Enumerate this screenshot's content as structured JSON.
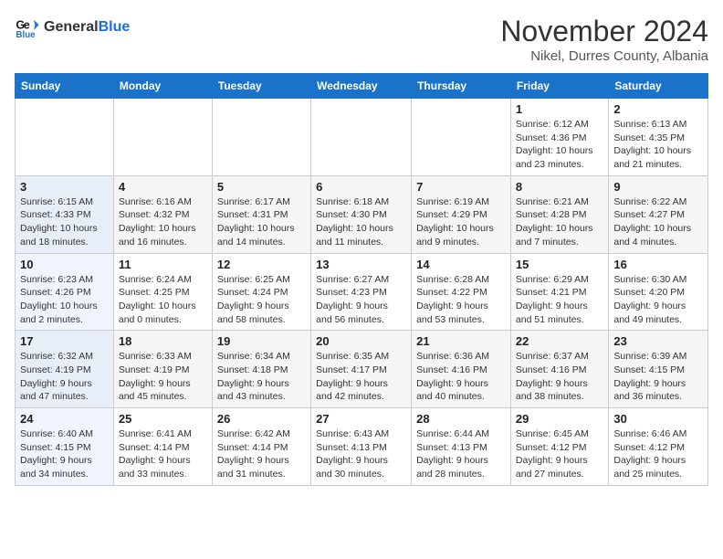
{
  "header": {
    "logo_line1": "General",
    "logo_line2": "Blue",
    "month": "November 2024",
    "location": "Nikel, Durres County, Albania"
  },
  "weekdays": [
    "Sunday",
    "Monday",
    "Tuesday",
    "Wednesday",
    "Thursday",
    "Friday",
    "Saturday"
  ],
  "weeks": [
    [
      {
        "day": "",
        "info": ""
      },
      {
        "day": "",
        "info": ""
      },
      {
        "day": "",
        "info": ""
      },
      {
        "day": "",
        "info": ""
      },
      {
        "day": "",
        "info": ""
      },
      {
        "day": "1",
        "info": "Sunrise: 6:12 AM\nSunset: 4:36 PM\nDaylight: 10 hours\nand 23 minutes."
      },
      {
        "day": "2",
        "info": "Sunrise: 6:13 AM\nSunset: 4:35 PM\nDaylight: 10 hours\nand 21 minutes."
      }
    ],
    [
      {
        "day": "3",
        "info": "Sunrise: 6:15 AM\nSunset: 4:33 PM\nDaylight: 10 hours\nand 18 minutes."
      },
      {
        "day": "4",
        "info": "Sunrise: 6:16 AM\nSunset: 4:32 PM\nDaylight: 10 hours\nand 16 minutes."
      },
      {
        "day": "5",
        "info": "Sunrise: 6:17 AM\nSunset: 4:31 PM\nDaylight: 10 hours\nand 14 minutes."
      },
      {
        "day": "6",
        "info": "Sunrise: 6:18 AM\nSunset: 4:30 PM\nDaylight: 10 hours\nand 11 minutes."
      },
      {
        "day": "7",
        "info": "Sunrise: 6:19 AM\nSunset: 4:29 PM\nDaylight: 10 hours\nand 9 minutes."
      },
      {
        "day": "8",
        "info": "Sunrise: 6:21 AM\nSunset: 4:28 PM\nDaylight: 10 hours\nand 7 minutes."
      },
      {
        "day": "9",
        "info": "Sunrise: 6:22 AM\nSunset: 4:27 PM\nDaylight: 10 hours\nand 4 minutes."
      }
    ],
    [
      {
        "day": "10",
        "info": "Sunrise: 6:23 AM\nSunset: 4:26 PM\nDaylight: 10 hours\nand 2 minutes."
      },
      {
        "day": "11",
        "info": "Sunrise: 6:24 AM\nSunset: 4:25 PM\nDaylight: 10 hours\nand 0 minutes."
      },
      {
        "day": "12",
        "info": "Sunrise: 6:25 AM\nSunset: 4:24 PM\nDaylight: 9 hours\nand 58 minutes."
      },
      {
        "day": "13",
        "info": "Sunrise: 6:27 AM\nSunset: 4:23 PM\nDaylight: 9 hours\nand 56 minutes."
      },
      {
        "day": "14",
        "info": "Sunrise: 6:28 AM\nSunset: 4:22 PM\nDaylight: 9 hours\nand 53 minutes."
      },
      {
        "day": "15",
        "info": "Sunrise: 6:29 AM\nSunset: 4:21 PM\nDaylight: 9 hours\nand 51 minutes."
      },
      {
        "day": "16",
        "info": "Sunrise: 6:30 AM\nSunset: 4:20 PM\nDaylight: 9 hours\nand 49 minutes."
      }
    ],
    [
      {
        "day": "17",
        "info": "Sunrise: 6:32 AM\nSunset: 4:19 PM\nDaylight: 9 hours\nand 47 minutes."
      },
      {
        "day": "18",
        "info": "Sunrise: 6:33 AM\nSunset: 4:19 PM\nDaylight: 9 hours\nand 45 minutes."
      },
      {
        "day": "19",
        "info": "Sunrise: 6:34 AM\nSunset: 4:18 PM\nDaylight: 9 hours\nand 43 minutes."
      },
      {
        "day": "20",
        "info": "Sunrise: 6:35 AM\nSunset: 4:17 PM\nDaylight: 9 hours\nand 42 minutes."
      },
      {
        "day": "21",
        "info": "Sunrise: 6:36 AM\nSunset: 4:16 PM\nDaylight: 9 hours\nand 40 minutes."
      },
      {
        "day": "22",
        "info": "Sunrise: 6:37 AM\nSunset: 4:16 PM\nDaylight: 9 hours\nand 38 minutes."
      },
      {
        "day": "23",
        "info": "Sunrise: 6:39 AM\nSunset: 4:15 PM\nDaylight: 9 hours\nand 36 minutes."
      }
    ],
    [
      {
        "day": "24",
        "info": "Sunrise: 6:40 AM\nSunset: 4:15 PM\nDaylight: 9 hours\nand 34 minutes."
      },
      {
        "day": "25",
        "info": "Sunrise: 6:41 AM\nSunset: 4:14 PM\nDaylight: 9 hours\nand 33 minutes."
      },
      {
        "day": "26",
        "info": "Sunrise: 6:42 AM\nSunset: 4:14 PM\nDaylight: 9 hours\nand 31 minutes."
      },
      {
        "day": "27",
        "info": "Sunrise: 6:43 AM\nSunset: 4:13 PM\nDaylight: 9 hours\nand 30 minutes."
      },
      {
        "day": "28",
        "info": "Sunrise: 6:44 AM\nSunset: 4:13 PM\nDaylight: 9 hours\nand 28 minutes."
      },
      {
        "day": "29",
        "info": "Sunrise: 6:45 AM\nSunset: 4:12 PM\nDaylight: 9 hours\nand 27 minutes."
      },
      {
        "day": "30",
        "info": "Sunrise: 6:46 AM\nSunset: 4:12 PM\nDaylight: 9 hours\nand 25 minutes."
      }
    ]
  ]
}
